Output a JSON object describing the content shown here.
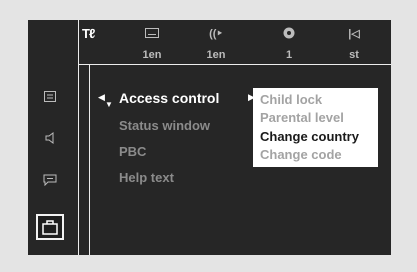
{
  "top_bar": {
    "setup_icon": "tools-icon",
    "items": [
      {
        "icon": "subtitle-icon",
        "label": "1en"
      },
      {
        "icon": "audio-icon",
        "label": "1en"
      },
      {
        "icon": "angle-icon",
        "label": "1"
      },
      {
        "icon": "sound-mode-icon",
        "label": "st"
      }
    ]
  },
  "sidebar": {
    "items": [
      {
        "icon": "display-setup-icon"
      },
      {
        "icon": "speaker-icon"
      },
      {
        "icon": "language-bubble-icon"
      },
      {
        "icon": "briefcase-icon",
        "selected": true
      }
    ]
  },
  "menu": {
    "items": [
      {
        "label": "Access control",
        "active": true
      },
      {
        "label": "Status window"
      },
      {
        "label": "PBC"
      },
      {
        "label": "Help text"
      }
    ]
  },
  "submenu": {
    "items": [
      {
        "label": "Child lock"
      },
      {
        "label": "Parental level"
      },
      {
        "label": "Change country",
        "selected": true
      },
      {
        "label": "Change code"
      }
    ]
  },
  "colors": {
    "background": "#262626",
    "frame": "#e4e4e4",
    "active_text": "#ffffff",
    "inactive_text": "#8b8b8b",
    "submenu_bg": "#ffffff"
  }
}
